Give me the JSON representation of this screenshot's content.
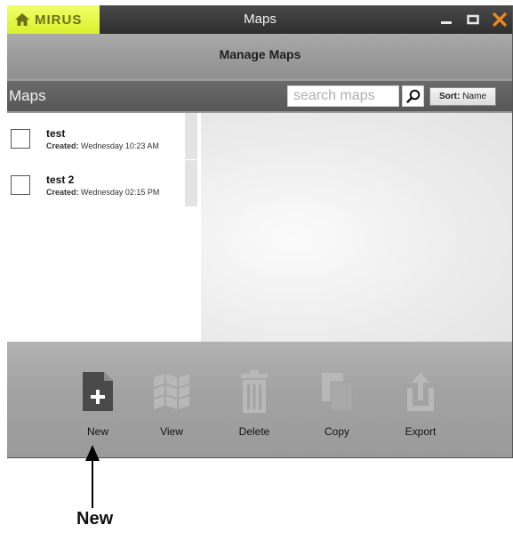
{
  "app": {
    "brand": "MIRUS",
    "title": "Maps",
    "subheader": "Manage Maps"
  },
  "colors": {
    "brand_bg": "#e4f43c",
    "titlebar_bg": "#3a3a3a",
    "close_accent": "#f08a1a",
    "window_bg": "#9a9a9a"
  },
  "maps_bar": {
    "label": "Maps",
    "search_placeholder": "search maps",
    "sort_prefix": "Sort:",
    "sort_value": "Name"
  },
  "maps": [
    {
      "name": "test",
      "created_label": "Created:",
      "created_value": "Wednesday 10:23 AM"
    },
    {
      "name": "test 2",
      "created_label": "Created:",
      "created_value": "Wednesday 02:15 PM"
    }
  ],
  "toolbar": {
    "items": [
      {
        "label": "New",
        "icon": "new-file-icon"
      },
      {
        "label": "View",
        "icon": "map-icon"
      },
      {
        "label": "Delete",
        "icon": "trash-icon"
      },
      {
        "label": "Copy",
        "icon": "copy-icon"
      },
      {
        "label": "Export",
        "icon": "export-icon"
      }
    ]
  },
  "callout": {
    "text": "New"
  }
}
